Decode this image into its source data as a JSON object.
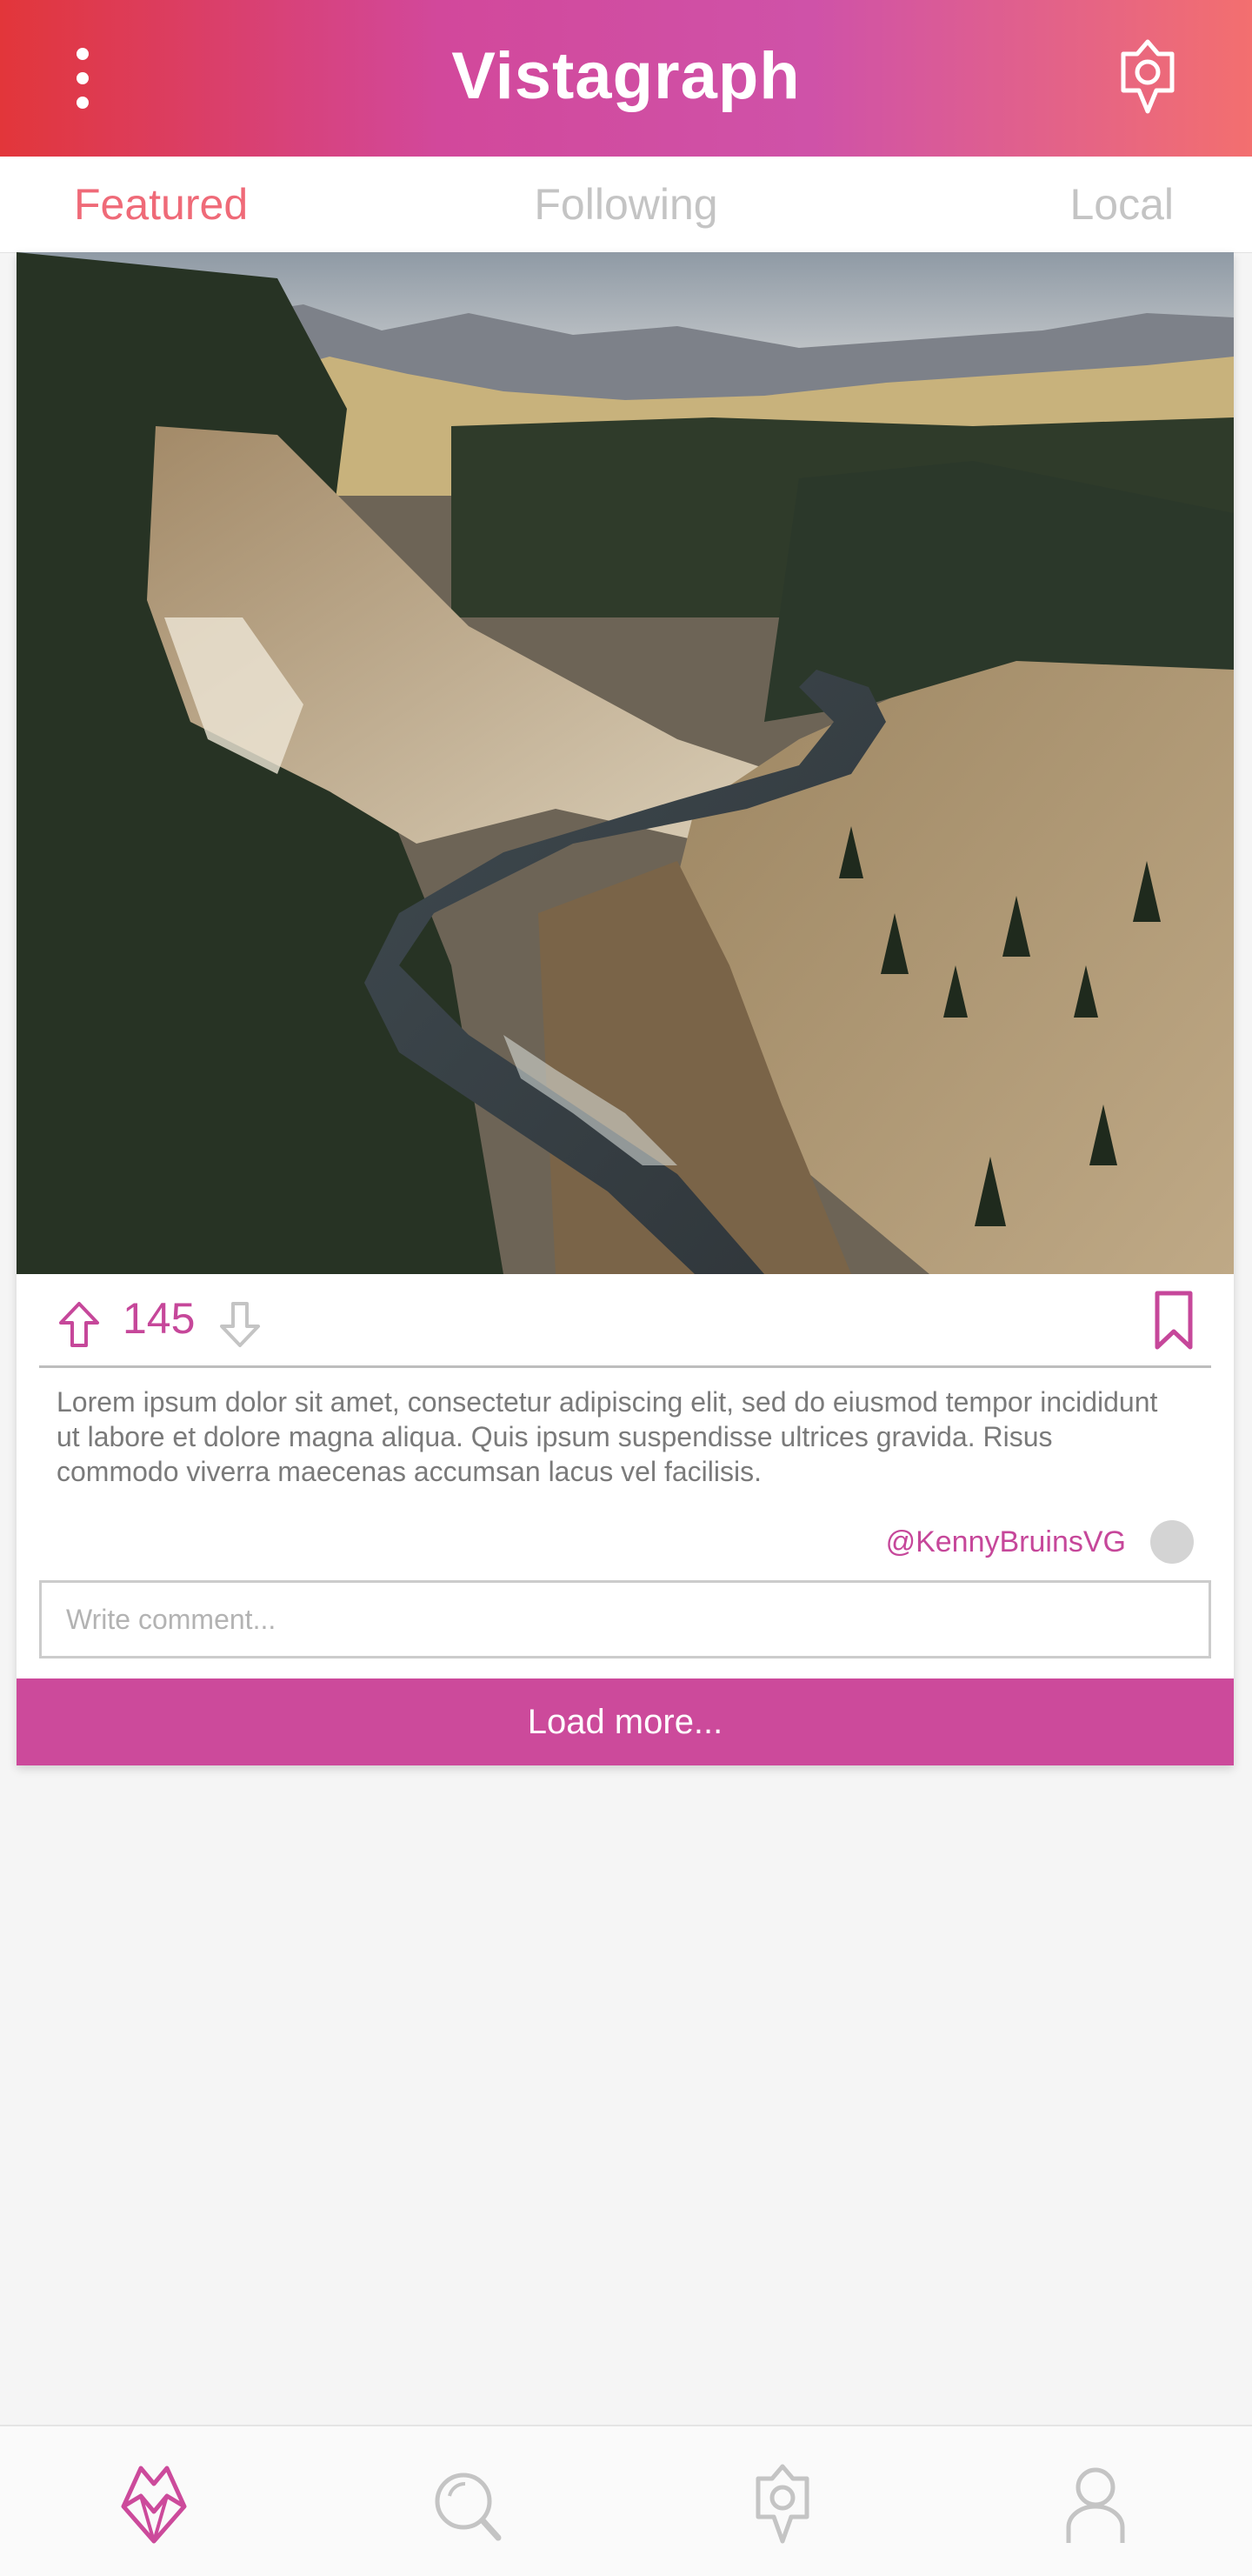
{
  "header": {
    "title": "Vistagraph",
    "menu_icon": "more-vertical-icon",
    "camera_icon": "camera-pin-icon"
  },
  "tabs": [
    {
      "label": "Featured",
      "active": true
    },
    {
      "label": "Following",
      "active": false
    },
    {
      "label": "Local",
      "active": false
    }
  ],
  "post": {
    "photo_description": "river-canyon-landscape",
    "votes": "145",
    "upvote_icon": "arrow-up-icon",
    "downvote_icon": "arrow-down-icon",
    "bookmark_icon": "bookmark-icon",
    "caption": "Lorem ipsum dolor sit amet, consectetur adipiscing elit, sed do eiusmod tempor incididunt ut labore et dolore magna aliqua. Quis ipsum suspendisse ultrices gravida. Risus commodo viverra maecenas accumsan lacus vel facilisis.",
    "author": "@KennyBruinsVG",
    "comment_placeholder": "Write comment...",
    "load_more_label": "Load more..."
  },
  "bottom_nav": {
    "items": [
      "home-crystal-icon",
      "search-icon",
      "camera-pin-icon",
      "profile-icon"
    ],
    "active_index": 0
  },
  "colors": {
    "accent": "#cc4a9b",
    "tab_active": "#ef6a78",
    "header_gradient_start": "#e2363a",
    "header_gradient_mid": "#d2489b",
    "header_gradient_end": "#f36f6f"
  }
}
